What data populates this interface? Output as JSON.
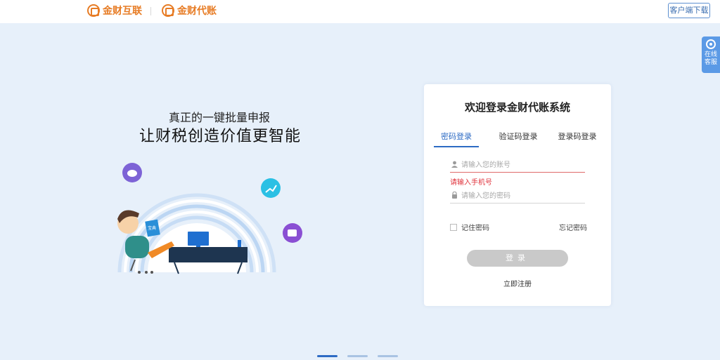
{
  "header": {
    "brand_primary": "金财互联",
    "brand_secondary": "金财代账",
    "download_label": "客户端下载"
  },
  "service_tab": {
    "line1": "在线",
    "line2": "客服"
  },
  "promo": {
    "subtitle": "真正的一键批量申报",
    "title": "让财税创造价值更智能",
    "illustration_badge": "宝典"
  },
  "login": {
    "title": "欢迎登录金财代账系统",
    "tabs": [
      "密码登录",
      "验证码登录",
      "登录码登录"
    ],
    "active_tab": 0,
    "account_placeholder": "请输入您的账号",
    "account_value": "",
    "account_error": "请输入手机号",
    "password_placeholder": "请输入您的密码",
    "password_value": "",
    "remember_label": "记住密码",
    "remember_checked": false,
    "forgot_label": "忘记密码",
    "submit_label": "登录",
    "register_label": "立即注册"
  },
  "carousel": {
    "slide_count": 3,
    "active_slide": 1
  },
  "colors": {
    "brand_orange": "#e77c25",
    "accent_blue": "#2d6bc4",
    "error_red": "#e0333c",
    "page_bg": "#e7f0fa"
  }
}
